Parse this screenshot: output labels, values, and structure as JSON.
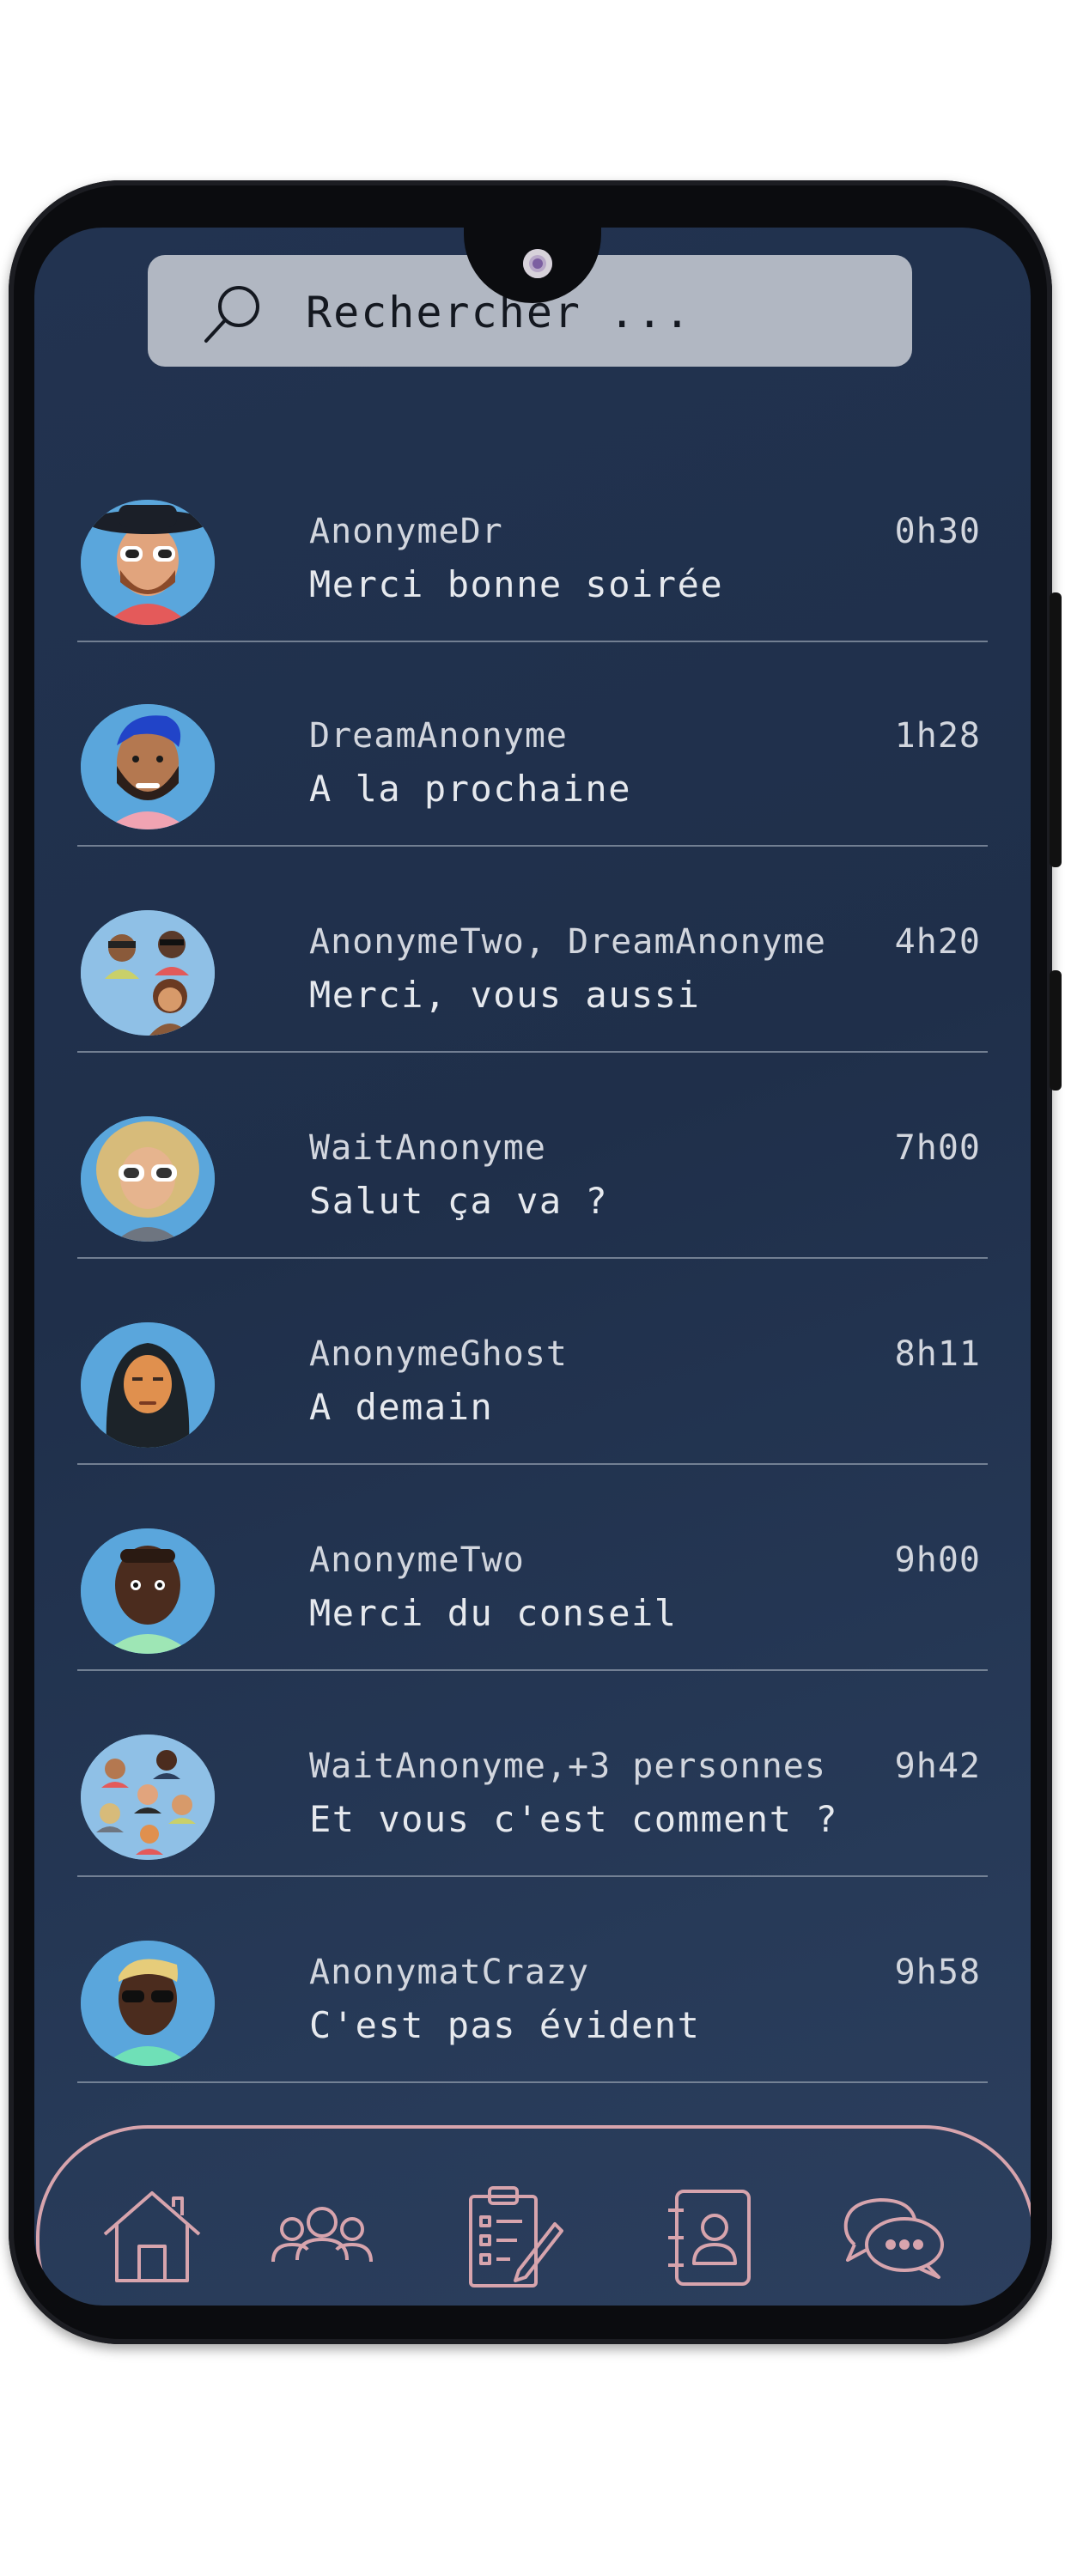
{
  "search": {
    "placeholder": "Rechercher ..."
  },
  "conversations": [
    {
      "name": "AnonymeDr",
      "message": "Merci bonne soirée",
      "time": "0h30",
      "avatar": "man-sunglasses-hat"
    },
    {
      "name": "DreamAnonyme",
      "message": "A la prochaine",
      "time": "1h28",
      "avatar": "man-blue-hair-beard"
    },
    {
      "name": "AnonymeTwo, DreamAnonyme",
      "message": "Merci, vous aussi",
      "time": "4h20",
      "avatar": "group-three"
    },
    {
      "name": "WaitAnonyme",
      "message": "Salut ça va ?",
      "time": "7h00",
      "avatar": "woman-blonde-sunglasses"
    },
    {
      "name": "AnonymeGhost",
      "message": "A demain",
      "time": "8h11",
      "avatar": "woman-hijab"
    },
    {
      "name": "AnonymeTwo",
      "message": "Merci du conseil",
      "time": "9h00",
      "avatar": "man-dark-skin"
    },
    {
      "name": "WaitAnonyme,+3 personnes",
      "message": "Et vous c'est comment ?",
      "time": "9h42",
      "avatar": "group-five"
    },
    {
      "name": "AnonymatCrazy",
      "message": "C'est pas évident",
      "time": "9h58",
      "avatar": "man-blonde-sunglasses"
    }
  ],
  "nav": [
    {
      "label": "home",
      "icon": "home-icon"
    },
    {
      "label": "groups",
      "icon": "people-icon"
    },
    {
      "label": "tasks",
      "icon": "clipboard-edit-icon"
    },
    {
      "label": "contacts",
      "icon": "contact-book-icon"
    },
    {
      "label": "messages",
      "icon": "chat-bubbles-icon"
    }
  ],
  "colors": {
    "screen_bg": "#223350",
    "search_bg": "#b1b7c2",
    "nav_accent": "#d7a4ad",
    "text": "#e6e9ee",
    "avatar_bg": "#5aa6dc"
  }
}
